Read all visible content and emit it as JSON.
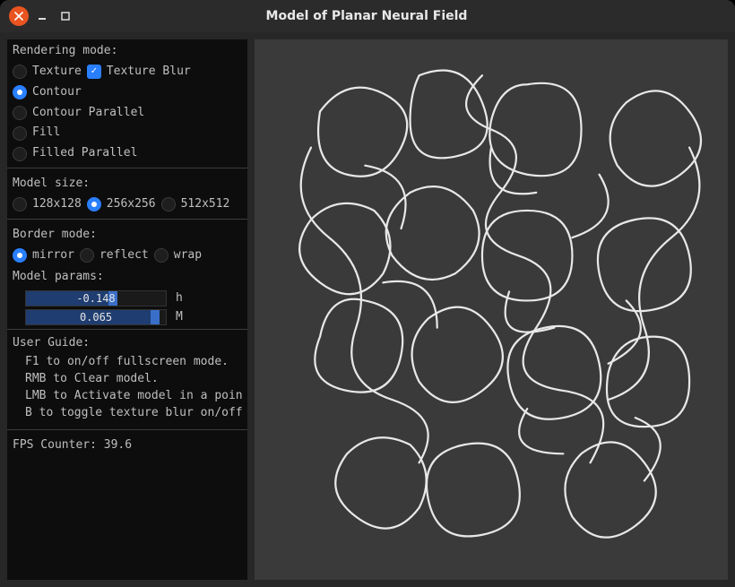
{
  "window": {
    "title": "Model of Planar Neural Field"
  },
  "rendering": {
    "label": "Rendering mode:",
    "texture": "Texture",
    "texture_blur": "Texture Blur",
    "texture_blur_checked": true,
    "options": [
      {
        "label": "Contour",
        "selected": true
      },
      {
        "label": "Contour Parallel",
        "selected": false
      },
      {
        "label": "Fill",
        "selected": false
      },
      {
        "label": "Filled Parallel",
        "selected": false
      }
    ]
  },
  "model_size": {
    "label": "Model size:",
    "options": [
      {
        "label": "128x128",
        "selected": false
      },
      {
        "label": "256x256",
        "selected": true
      },
      {
        "label": "512x512",
        "selected": false
      }
    ]
  },
  "border_mode": {
    "label": "Border mode:",
    "options": [
      {
        "label": "mirror",
        "selected": true
      },
      {
        "label": "reflect",
        "selected": false
      },
      {
        "label": "wrap",
        "selected": false
      }
    ]
  },
  "model_params": {
    "label": "Model params:",
    "sliders": [
      {
        "name": "h",
        "value": "-0.148",
        "fill_pct": 62,
        "handle_pct": 62
      },
      {
        "name": "M",
        "value": "0.065",
        "fill_pct": 92,
        "handle_pct": 92
      }
    ]
  },
  "user_guide": {
    "label": "User Guide:",
    "items": [
      "F1 to on/off fullscreen mode.",
      "RMB to Clear model.",
      "LMB to Activate model in a poin",
      "B to toggle texture blur on/off"
    ]
  },
  "fps": {
    "label": "FPS Counter: ",
    "value": "39.6"
  }
}
